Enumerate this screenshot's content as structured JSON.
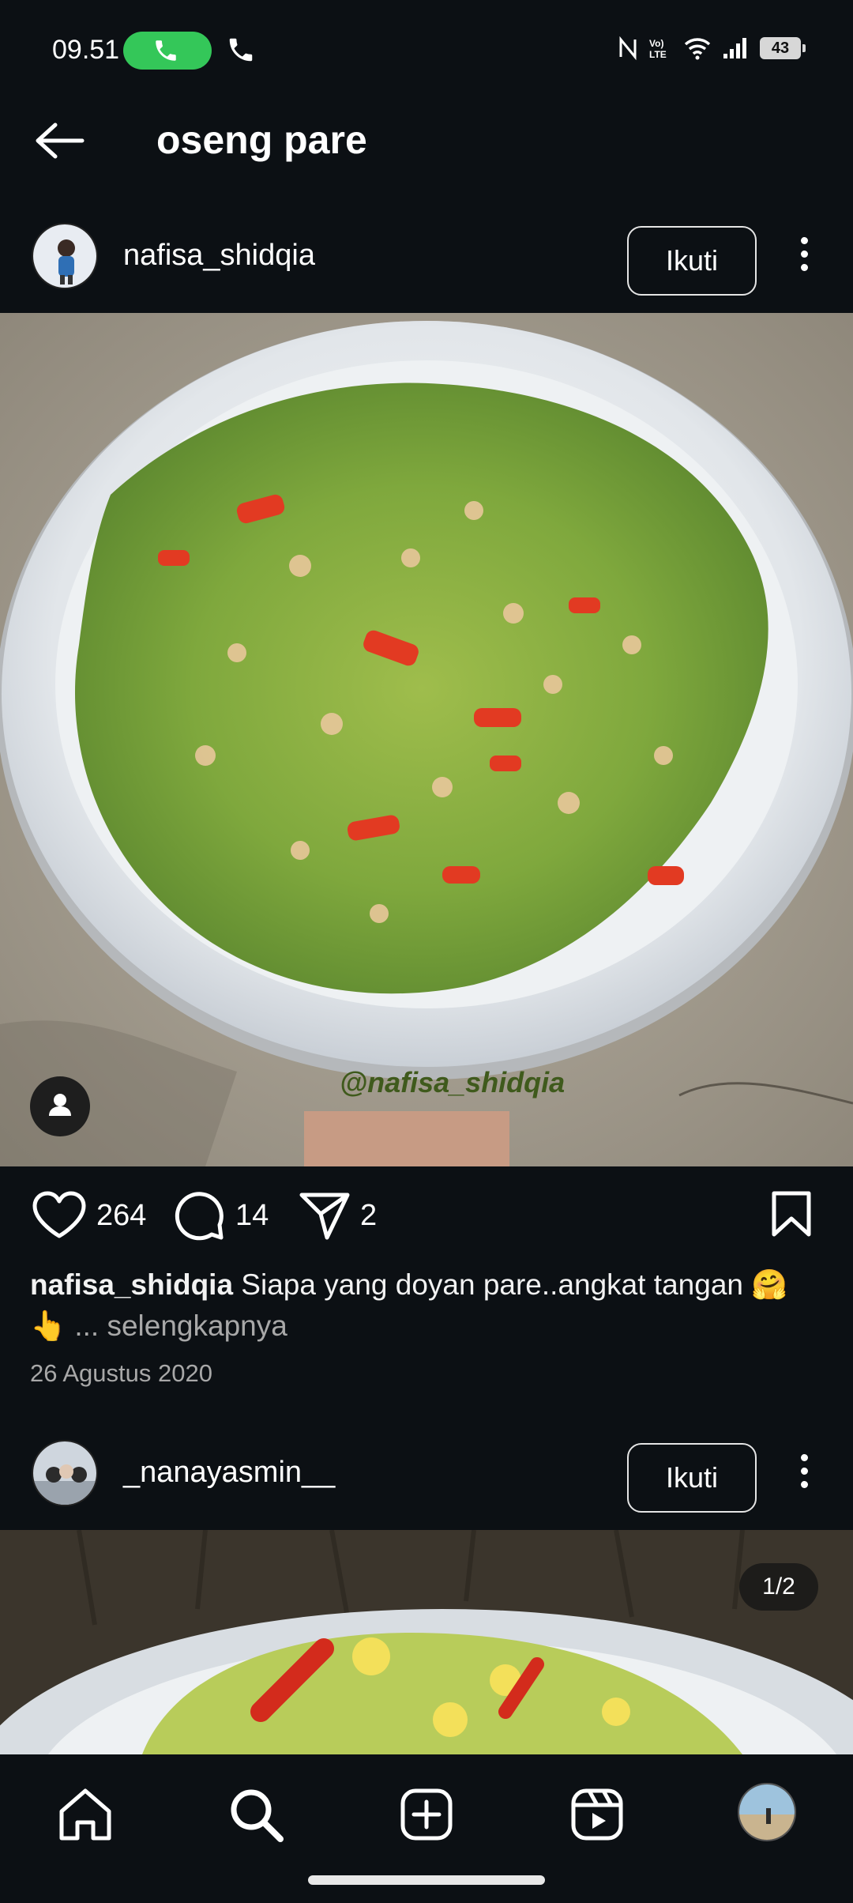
{
  "status_bar": {
    "time": "09.51",
    "battery": "43",
    "indicators": [
      "nfc-icon",
      "volte-icon",
      "wifi-icon",
      "signal-icon",
      "battery-icon"
    ]
  },
  "header": {
    "title": "oseng pare",
    "back_icon": "arrow-left-icon"
  },
  "posts": [
    {
      "username": "nafisa_shidqia",
      "follow_label": "Ikuti",
      "watermark": "@nafisa_shidqia",
      "likes": "264",
      "comments": "14",
      "shares": "2",
      "caption_user": "nafisa_shidqia",
      "caption_text": " Siapa yang doyan pare..angkat tangan 🤗",
      "caption_text_2": "👆",
      "caption_more": " ... selengkapnya",
      "date": "26 Agustus 2020"
    },
    {
      "username": "_nanayasmin__",
      "follow_label": "Ikuti",
      "page_counter": "1/2"
    }
  ],
  "bottom_nav": {
    "items": [
      "home-icon",
      "search-icon",
      "create-icon",
      "reels-icon",
      "profile-avatar"
    ]
  },
  "colors": {
    "background": "#0c1014",
    "call_pill": "#34c759",
    "text": "#f5f5f5",
    "muted": "#a8a8a8"
  }
}
